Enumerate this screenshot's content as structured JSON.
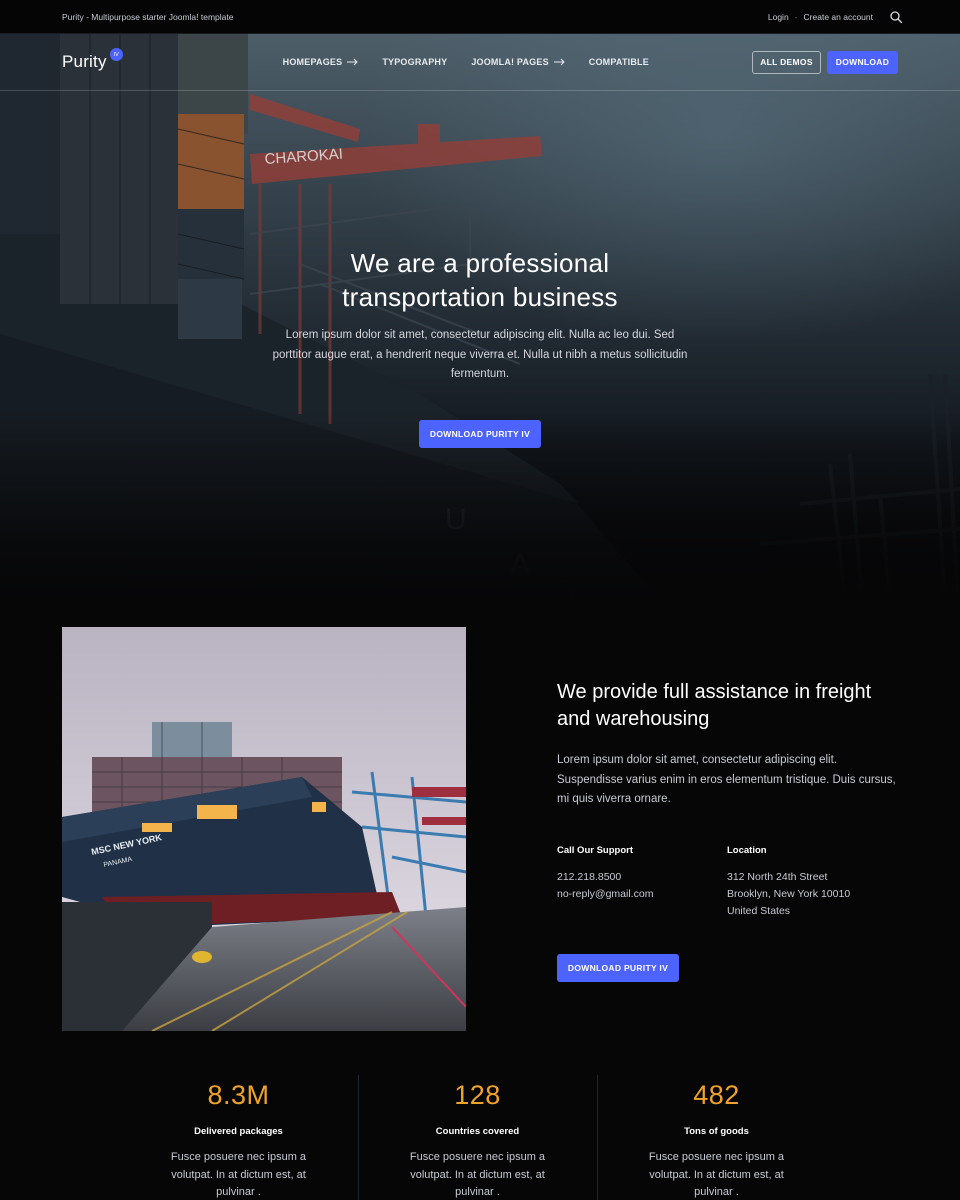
{
  "topbar": {
    "tagline": "Purity - Multipurpose starter Joomla! template",
    "login": "Login",
    "separator": "-",
    "create_account": "Create an account",
    "icon": "search-icon"
  },
  "nav": {
    "logo": "Purity",
    "logo_badge": "IV",
    "menu": [
      {
        "label": "HOMEPAGES",
        "has_arrow": true
      },
      {
        "label": "TYPOGRAPHY",
        "has_arrow": false
      },
      {
        "label": "JOOMLA! PAGES",
        "has_arrow": true
      },
      {
        "label": "COMPATIBLE",
        "has_arrow": false
      }
    ],
    "all_demos": "ALL DEMOS",
    "download": "DOWNLOAD"
  },
  "hero": {
    "title_line1": "We are a professional",
    "title_line2": "transportation business",
    "text": "Lorem ipsum dolor sit amet, consectetur adipiscing elit. Nulla ac leo dui. Sed porttitor augue erat, a hendrerit neque viverra et. Nulla ut nibh a metus sollicitudin fermentum.",
    "button": "DOWNLOAD PURITY IV"
  },
  "about": {
    "title": "We provide full assistance in freight and warehousing",
    "text": "Lorem ipsum dolor sit amet, consectetur adipiscing elit. Suspendisse varius enim in eros elementum tristique. Duis cursus, mi quis viverra ornare.",
    "support": {
      "label": "Call Our Support",
      "phone": "212.218.8500",
      "email": "no-reply@gmail.com"
    },
    "location": {
      "label": "Location",
      "line1": "312 North 24th Street",
      "line2": "Brooklyn, New York 10010",
      "line3": "United States"
    },
    "button": "DOWNLOAD PURITY IV"
  },
  "stats": [
    {
      "value": "8.3M",
      "label": "Delivered packages",
      "text": "Fusce posuere nec ipsum a volutpat. In at dictum est, at pulvinar ."
    },
    {
      "value": "128",
      "label": "Countries covered",
      "text": "Fusce posuere nec ipsum a volutpat. In at dictum est, at pulvinar ."
    },
    {
      "value": "482",
      "label": "Tons of goods",
      "text": "Fusce posuere nec ipsum a volutpat. In at dictum est, at pulvinar ."
    }
  ],
  "colors": {
    "accent": "#4c63ff",
    "stat_value": "#f0a32a",
    "background": "#060607"
  }
}
